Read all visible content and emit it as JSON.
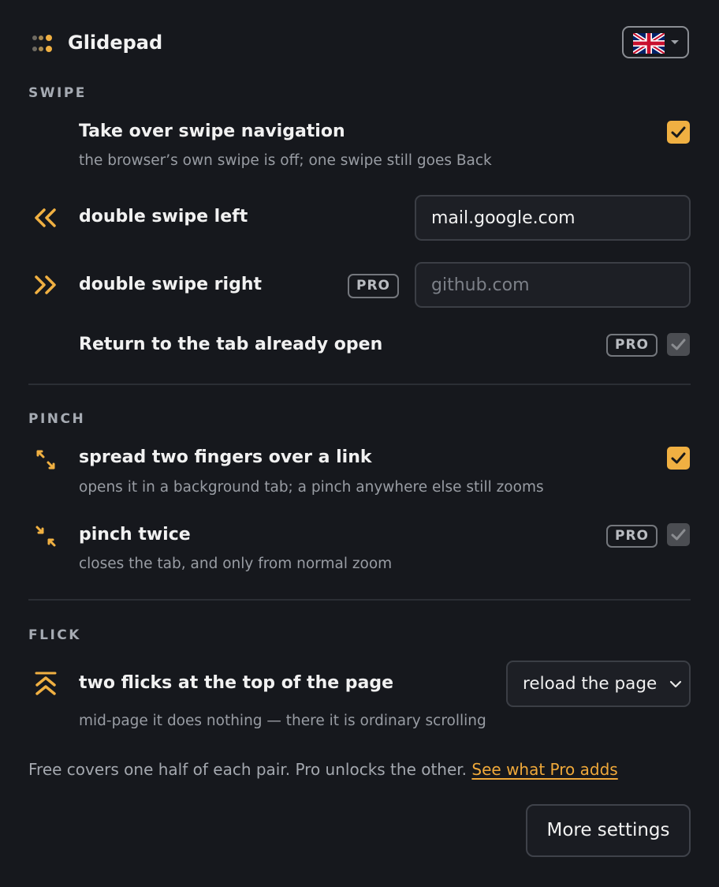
{
  "header": {
    "title": "Glidepad",
    "language_flag": "united-kingdom-flag"
  },
  "sections": {
    "swipe": {
      "label": "SWIPE",
      "takeover": {
        "title": "Take over swipe navigation",
        "desc": "the browser’s own swipe is off; one swipe still goes Back",
        "checked": true
      },
      "double_left": {
        "title": "double swipe left",
        "value": "mail.google.com",
        "icon": "double-chevron-left-icon"
      },
      "double_right": {
        "title": "double swipe right",
        "badge": "PRO",
        "placeholder": "github.com",
        "icon": "double-chevron-right-icon"
      },
      "return_tab": {
        "title": "Return to the tab already open",
        "badge": "PRO",
        "checked": true
      }
    },
    "pinch": {
      "label": "PINCH",
      "spread": {
        "title": "spread two fingers over a link",
        "desc": "opens it in a background tab; a pinch anywhere else still zooms",
        "checked": true,
        "icon": "expand-arrows-icon"
      },
      "pinch_twice": {
        "title": "pinch twice",
        "desc": "closes the tab, and only from normal zoom",
        "badge": "PRO",
        "checked": true,
        "icon": "collapse-arrows-icon"
      }
    },
    "flick": {
      "label": "FLICK",
      "top_flicks": {
        "title": "two flicks at the top of the page",
        "desc": "mid-page it does nothing — there it is ordinary scrolling",
        "select_value": "reload the page",
        "icon": "double-chevron-up-icon"
      }
    }
  },
  "footer": {
    "text": "Free covers one half of each pair. Pro unlocks the other. ",
    "link": "See what Pro adds",
    "more_settings": "More settings"
  },
  "colors": {
    "accent": "#f0b042",
    "background": "#16181d",
    "disabled_checkbox": "#4b4d52"
  }
}
